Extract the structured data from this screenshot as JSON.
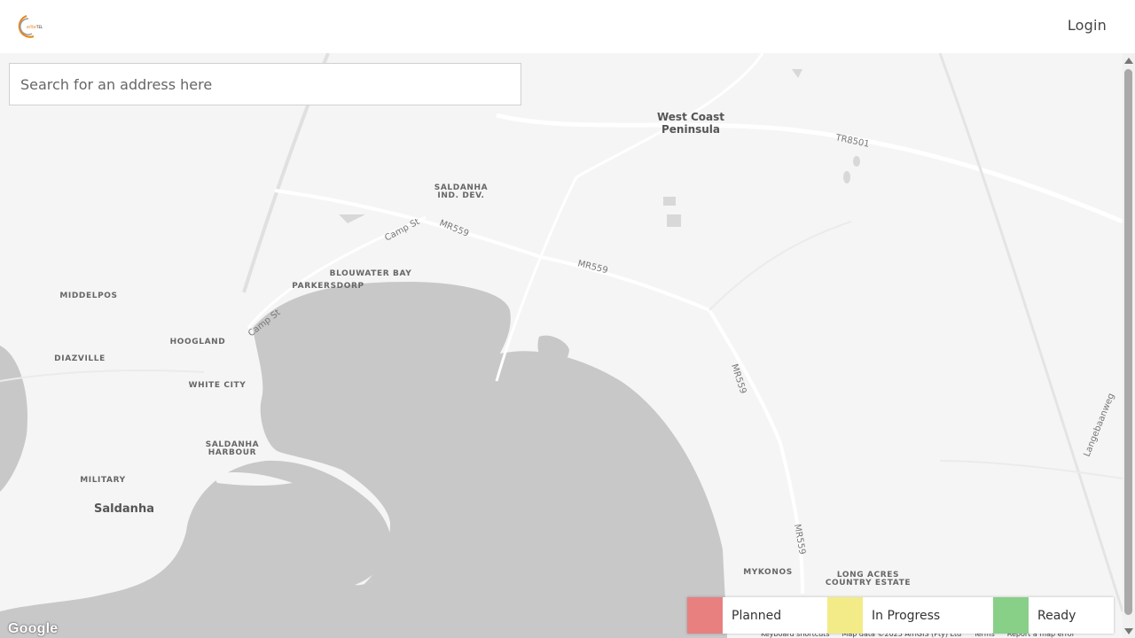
{
  "header": {
    "login_label": "Login"
  },
  "search": {
    "placeholder": "Search for an address here"
  },
  "map": {
    "labels": {
      "west_coast_1": "West Coast",
      "west_coast_2": "Peninsula",
      "tr8501": "TR8501",
      "saldanha_ind_1": "SALDANHA",
      "saldanha_ind_2": "IND. DEV.",
      "camp_st_1": "Camp St",
      "mr559_1": "MR559",
      "mr559_2": "MR559",
      "mr559_3": "MR559",
      "mr559_4": "MR559",
      "blouwater": "BLOUWATER BAY",
      "parkersdorp": "PARKERSDORP",
      "camp_st_2": "Camp St",
      "middelpos": "MIDDELPOS",
      "hoogland": "HOOGLAND",
      "diazville": "DIAZVILLE",
      "white_city": "WHITE CITY",
      "saldanha_harbour_1": "SALDANHA",
      "saldanha_harbour_2": "HARBOUR",
      "military": "MILITARY",
      "saldanha": "Saldanha",
      "mykonos": "MYKONOS",
      "long_acres_1": "LONG ACRES",
      "long_acres_2": "COUNTRY ESTATE",
      "langebaanweg": "Langebaanweg"
    },
    "google_logo": "Google",
    "attribution": {
      "shortcuts": "Keyboard shortcuts",
      "map_data": "Map data ©2025 AfriGIS (Pty) Ltd",
      "terms": "Terms",
      "report": "Report a map error"
    }
  },
  "legend": {
    "items": [
      {
        "label": "Planned",
        "color": "#e88080"
      },
      {
        "label": "In Progress",
        "color": "#f3eb88"
      },
      {
        "label": "Ready",
        "color": "#88cf88"
      }
    ]
  },
  "colors": {
    "water": "#c8c8c8",
    "land": "#f5f5f5",
    "road": "#ffffff"
  }
}
